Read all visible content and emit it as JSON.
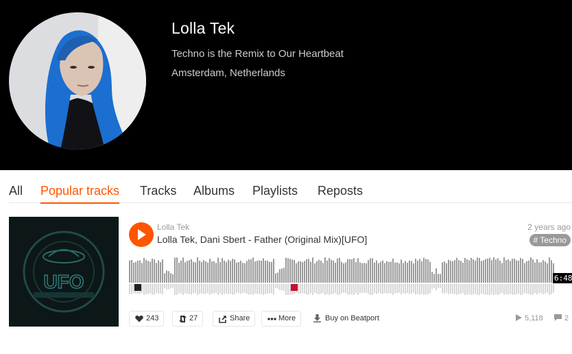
{
  "profile": {
    "name": "Lolla Tek",
    "bio": "Techno is the Remix to Our Heartbeat",
    "location": "Amsterdam, Netherlands"
  },
  "tabs": [
    {
      "label": "All",
      "active": false
    },
    {
      "label": "Popular tracks",
      "active": true
    },
    {
      "label": "Tracks",
      "active": false
    },
    {
      "label": "Albums",
      "active": false
    },
    {
      "label": "Playlists",
      "active": false
    },
    {
      "label": "Reposts",
      "active": false
    }
  ],
  "track": {
    "artist": "Lolla Tek",
    "title": "Lolla Tek, Dani Sbert - Father (Original Mix)[UFO]",
    "posted": "2 years ago",
    "genre": "# Techno",
    "duration": "6:48",
    "artwork_text": "UFO",
    "likes": "243",
    "reposts": "27",
    "share_label": "Share",
    "more_label": "More",
    "buy_label": "Buy on Beatport",
    "plays": "5,118",
    "comments": "2"
  },
  "colors": {
    "accent": "#ff5500",
    "header_bg": "#000000",
    "waveform": "#999999",
    "waveform_reflection": "#d6d6d6"
  },
  "icons": {
    "play": "play-icon",
    "like": "heart-icon",
    "repost": "repost-icon",
    "share": "share-icon",
    "more": "more-icon",
    "buy": "download-icon",
    "plays": "play-count-icon",
    "comments": "comment-icon"
  }
}
